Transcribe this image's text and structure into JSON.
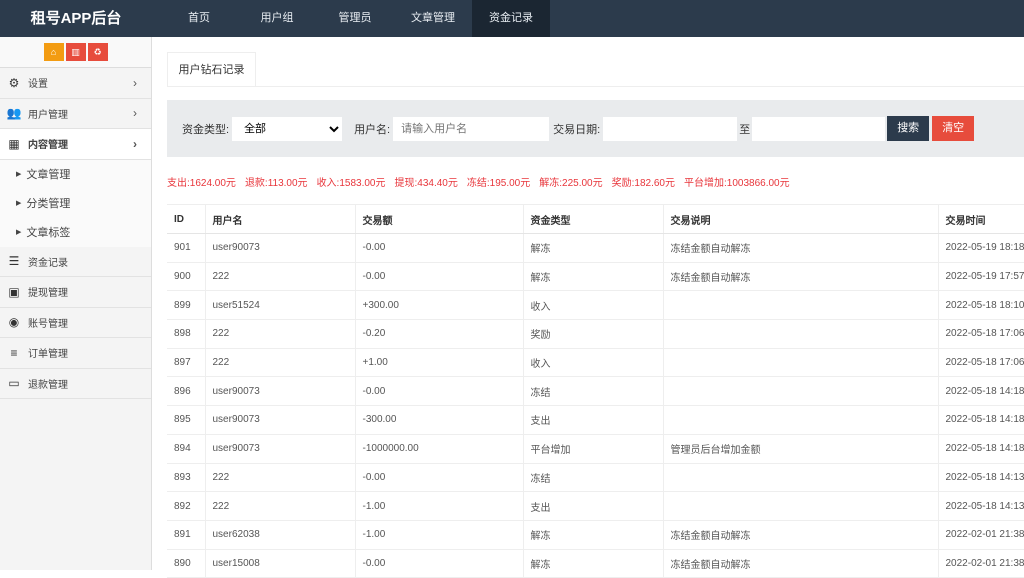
{
  "app_title": "租号APP后台",
  "nav": [
    {
      "label": "首页"
    },
    {
      "label": "用户组"
    },
    {
      "label": "管理员"
    },
    {
      "label": "文章管理"
    },
    {
      "label": "资金记录",
      "active": true
    }
  ],
  "quick_buttons": [
    {
      "icon": "home-icon",
      "color": "#f39c12"
    },
    {
      "icon": "trash-icon",
      "color": "#e74c3c"
    },
    {
      "icon": "recycle-icon",
      "color": "#e74c3c"
    }
  ],
  "sidebar": [
    {
      "label": "设置",
      "icon": "gears-icon",
      "glyph": "⚙",
      "chev": true
    },
    {
      "label": "用户管理",
      "icon": "users-icon",
      "glyph": "👥",
      "chev": true
    },
    {
      "label": "内容管理",
      "icon": "grid-icon",
      "glyph": "▦",
      "chev": true,
      "open": true,
      "children": [
        {
          "label": "文章管理"
        },
        {
          "label": "分类管理"
        },
        {
          "label": "文章标签"
        }
      ]
    },
    {
      "label": "资金记录",
      "icon": "list-icon",
      "glyph": "☰"
    },
    {
      "label": "提现管理",
      "icon": "money-icon",
      "glyph": "▣"
    },
    {
      "label": "账号管理",
      "icon": "gamepad-icon",
      "glyph": "◉"
    },
    {
      "label": "订单管理",
      "icon": "bars-icon",
      "glyph": "≡"
    },
    {
      "label": "退款管理",
      "icon": "monitor-icon",
      "glyph": "▭"
    }
  ],
  "tab": "用户钻石记录",
  "filters": {
    "type_label": "资金类型:",
    "type_value": "全部",
    "user_label": "用户名:",
    "user_placeholder": "请输入用户名",
    "date_label": "交易日期:",
    "to_label": "至",
    "search": "搜索",
    "clear": "清空"
  },
  "colors": {
    "search": "#2c3b4c",
    "clear": "#e74c3c",
    "summary": "#e8353b"
  },
  "summary": [
    "支出:1624.00元",
    "退款:113.00元",
    "收入:1583.00元",
    "提现:434.40元",
    "冻结:195.00元",
    "解冻:225.00元",
    "奖励:182.60元",
    "平台增加:1003866.00元"
  ],
  "table": {
    "headers": [
      "ID",
      "用户名",
      "交易额",
      "资金类型",
      "交易说明",
      "交易时间"
    ],
    "rows": [
      [
        "901",
        "user90073",
        "-0.00",
        "解冻",
        "冻结金额自动解冻",
        "2022-05-19 18:18"
      ],
      [
        "900",
        "222",
        "-0.00",
        "解冻",
        "冻结金额自动解冻",
        "2022-05-19 17:57"
      ],
      [
        "899",
        "user51524",
        "+300.00",
        "收入",
        "",
        "2022-05-18 18:10"
      ],
      [
        "898",
        "222",
        "-0.20",
        "奖励",
        "",
        "2022-05-18 17:06"
      ],
      [
        "897",
        "222",
        "+1.00",
        "收入",
        "",
        "2022-05-18 17:06"
      ],
      [
        "896",
        "user90073",
        "-0.00",
        "冻结",
        "",
        "2022-05-18 14:18"
      ],
      [
        "895",
        "user90073",
        "-300.00",
        "支出",
        "",
        "2022-05-18 14:18"
      ],
      [
        "894",
        "user90073",
        "-1000000.00",
        "平台增加",
        "管理员后台增加金额",
        "2022-05-18 14:18"
      ],
      [
        "893",
        "222",
        "-0.00",
        "冻结",
        "",
        "2022-05-18 14:13"
      ],
      [
        "892",
        "222",
        "-1.00",
        "支出",
        "",
        "2022-05-18 14:13"
      ],
      [
        "891",
        "user62038",
        "-1.00",
        "解冻",
        "冻结金额自动解冻",
        "2022-02-01 21:38"
      ],
      [
        "890",
        "user15008",
        "-0.00",
        "解冻",
        "冻结金额自动解冻",
        "2022-02-01 21:38"
      ]
    ]
  }
}
